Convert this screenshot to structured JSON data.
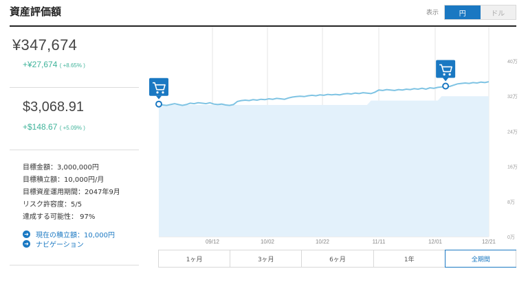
{
  "header": {
    "title": "資産評価額"
  },
  "display_toggle": {
    "label": "表示",
    "options": [
      "円",
      "ドル"
    ],
    "selected": "円"
  },
  "summary": {
    "yen": {
      "value": "¥347,674",
      "change": "+¥27,674",
      "change_pct": "( +8.65% )"
    },
    "usd": {
      "value": "$3,068.91",
      "change": "+$148.67",
      "change_pct": "( +5.09% )"
    }
  },
  "goals": [
    "目標金額：3,000,000円",
    "目標積立額：10,000円/月",
    "目標資産運用期間：2047年9月",
    "リスク許容度：5/5",
    "達成する可能性：  97%"
  ],
  "links": [
    {
      "label": "現在の積立額：10,000円"
    },
    {
      "label": "ナビゲーション"
    }
  ],
  "chart_data": {
    "type": "area",
    "x_ticks": [
      "09/12",
      "10/02",
      "10/22",
      "11/11",
      "12/01",
      "12/21"
    ],
    "y_ticks": [
      "0万",
      "8万",
      "16万",
      "24万",
      "32万",
      "40万"
    ],
    "ylim": [
      0,
      40
    ],
    "y_unit": "万",
    "grid": true,
    "series": [
      {
        "values": [
          30.2,
          30.0,
          29.9,
          30.1,
          30.3,
          30.1,
          29.9,
          30.1,
          30.4,
          30.3,
          30.5,
          30.4,
          30.3,
          30.5,
          30.2,
          30.1,
          30.2,
          30.0,
          29.9,
          30.1,
          30.8,
          31.0,
          31.1,
          31.0,
          31.2,
          31.1,
          31.3,
          31.2,
          31.4,
          31.3,
          31.5,
          31.4,
          31.3,
          31.6,
          31.8,
          31.9,
          32.0,
          31.9,
          32.1,
          32.2,
          32.1,
          32.3,
          32.2,
          32.4,
          32.3,
          32.4,
          32.3,
          32.5,
          32.6,
          32.5,
          32.7,
          32.6,
          32.8,
          32.7,
          32.6,
          32.9,
          33.4,
          33.3,
          33.5,
          33.4,
          33.3,
          33.5,
          33.4,
          33.6,
          33.5,
          33.7,
          33.6,
          33.8,
          33.6,
          33.9,
          33.8,
          34.0,
          34.1,
          34.3,
          34.2,
          34.5,
          34.8,
          34.9,
          35.0,
          34.9,
          35.1,
          35.0,
          35.2,
          35.1,
          35.3
        ]
      },
      {
        "values": [
          30.0,
          30.0,
          30.0,
          30.0,
          30.0,
          30.0,
          30.0,
          30.0,
          30.0,
          30.0,
          30.0,
          30.0,
          30.0,
          30.0,
          30.0,
          30.0,
          30.0,
          30.0,
          30.0,
          30.0,
          30.0,
          30.0,
          30.0,
          30.0,
          30.0,
          30.0,
          30.0,
          30.0,
          30.0,
          30.0,
          30.0,
          30.0,
          30.0,
          30.0,
          30.0,
          30.0,
          30.0,
          30.0,
          30.0,
          30.0,
          30.0,
          30.0,
          30.0,
          30.0,
          30.0,
          30.0,
          30.0,
          30.0,
          30.0,
          30.0,
          30.0,
          30.0,
          30.0,
          30.0,
          31.0,
          31.0,
          31.0,
          31.0,
          31.0,
          31.0,
          31.0,
          31.0,
          31.0,
          31.0,
          31.0,
          31.0,
          31.0,
          31.0,
          31.0,
          31.0,
          31.0,
          31.0,
          32.0,
          32.0,
          32.0,
          32.0,
          32.0,
          32.0,
          32.0,
          32.0,
          32.0,
          32.0,
          32.0,
          32.0,
          32.0
        ]
      }
    ],
    "purchase_markers": [
      0,
      73
    ]
  },
  "range_tabs": [
    "1ヶ月",
    "3ヶ月",
    "6ヶ月",
    "1年",
    "全期間"
  ],
  "range_selected": "全期間",
  "colors": {
    "accent": "#1a78c2",
    "positive": "#3fb39a",
    "line": "#7ec3e3",
    "area": "#e3f1fb"
  }
}
